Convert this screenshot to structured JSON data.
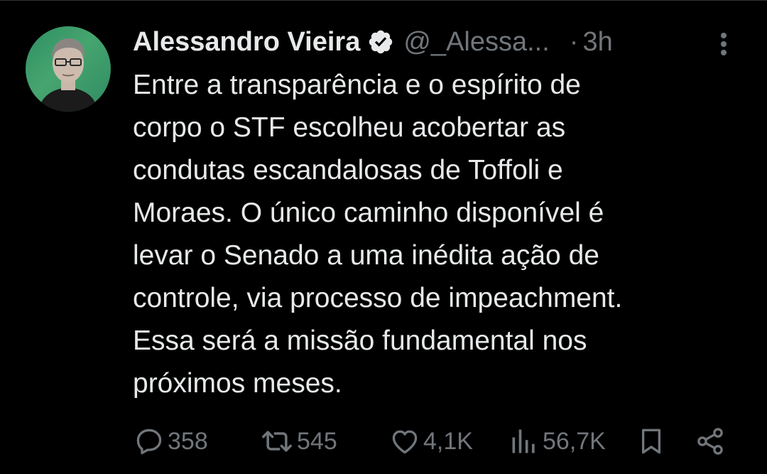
{
  "post": {
    "author_name": "Alessandro Vieira",
    "handle": "@_Alessa...",
    "separator": "·",
    "time": "3h",
    "text_lines": [
      "Entre a transparência e o espírito de",
      "corpo o STF escolheu acobertar as",
      "condutas escandalosas de Toffoli e",
      "Moraes. O único caminho disponível é",
      "levar o Senado a uma inédita ação de",
      "controle, via processo de impeachment.",
      "Essa será a missão fundamental nos",
      "próximos meses."
    ]
  },
  "actions": {
    "replies": "358",
    "reposts": "545",
    "likes": "4,1K",
    "views": "56,7K"
  },
  "icons": {
    "verified": "verified-badge-icon",
    "more": "more-vertical-icon",
    "reply": "reply-icon",
    "repost": "repost-icon",
    "like": "heart-icon",
    "views": "views-chart-icon",
    "bookmark": "bookmark-icon",
    "share": "share-icon"
  },
  "colors": {
    "background": "#000000",
    "text": "#e7e9ea",
    "muted": "#71767b",
    "verified_badge": "#e7e9ea"
  }
}
